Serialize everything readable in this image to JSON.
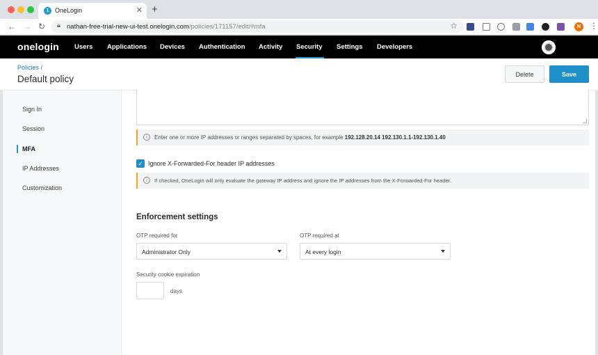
{
  "browser": {
    "tab_title": "OneLogin",
    "tab_favicon_text": "1",
    "url_host": "nathan-free-trial-new-ui-test.onelogin.com",
    "url_path": "/policies/171157/edit/#mfa",
    "profile_initial": "N"
  },
  "nav": {
    "logo": "onelogin",
    "items": [
      "Users",
      "Applications",
      "Devices",
      "Authentication",
      "Activity",
      "Security",
      "Settings",
      "Developers"
    ],
    "active": "Security",
    "accent_color": "#1c9bd7"
  },
  "header": {
    "breadcrumb": "Policies /",
    "title": "Default policy",
    "delete_label": "Delete",
    "save_label": "Save"
  },
  "sidebar": {
    "items": [
      "Sign In",
      "Session",
      "MFA",
      "IP Addresses",
      "Customization"
    ],
    "active": "MFA"
  },
  "ip": {
    "hint_prefix": "Enter one or more IP addresses or ranges separated by spaces, for example ",
    "hint_example": "192.128.20.14 192.130.1.1-192.130.1.40",
    "forwarded_checkbox_label": "Ignore X-Forwarded-For header IP addresses",
    "forwarded_checked": true,
    "forwarded_hint": "If checked, OneLogin will only evaluate the gateway IP address and ignore the IP addresses from the X-Forwarded-For header."
  },
  "enforcement": {
    "title": "Enforcement settings",
    "otp_for_label": "OTP required for",
    "otp_for_value": "Administrator Only",
    "otp_at_label": "OTP required at",
    "otp_at_value": "At every login",
    "cookie_label": "Security cookie expiration",
    "cookie_value": "",
    "cookie_unit": "days"
  }
}
